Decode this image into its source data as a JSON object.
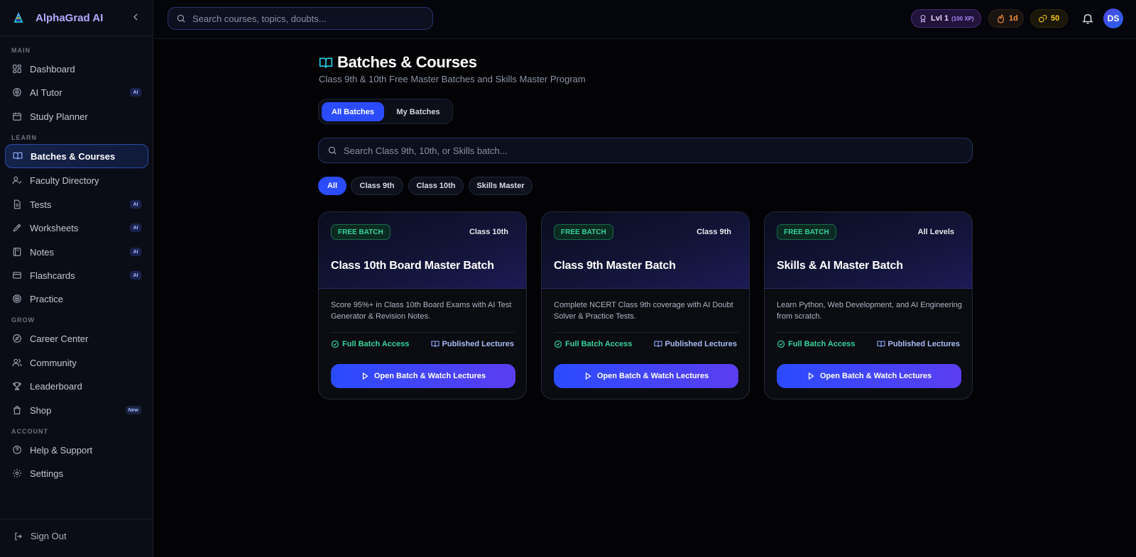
{
  "app": {
    "name": "AlphaGrad AI"
  },
  "topbar": {
    "search_placeholder": "Search courses, topics, doubts...",
    "level": "Lvl 1",
    "xp": "(100 XP)",
    "streak": "1d",
    "coins": "50",
    "avatar_initials": "DS"
  },
  "sidebar": {
    "sections": [
      "MAIN",
      "LEARN",
      "GROW",
      "ACCOUNT"
    ],
    "items": [
      {
        "label": "Dashboard",
        "icon": "dashboard-icon"
      },
      {
        "label": "AI Tutor",
        "icon": "brain-icon",
        "badge": "AI"
      },
      {
        "label": "Study Planner",
        "icon": "calendar-icon"
      },
      {
        "label": "Batches & Courses",
        "icon": "book-open-icon",
        "active": true
      },
      {
        "label": "Faculty Directory",
        "icon": "user-check-icon"
      },
      {
        "label": "Tests",
        "icon": "file-text-icon",
        "badge": "AI"
      },
      {
        "label": "Worksheets",
        "icon": "pen-icon",
        "badge": "AI"
      },
      {
        "label": "Notes",
        "icon": "notebook-icon",
        "badge": "AI"
      },
      {
        "label": "Flashcards",
        "icon": "cards-icon",
        "badge": "AI"
      },
      {
        "label": "Practice",
        "icon": "target-icon"
      },
      {
        "label": "Career Center",
        "icon": "compass-icon"
      },
      {
        "label": "Community",
        "icon": "users-icon"
      },
      {
        "label": "Leaderboard",
        "icon": "trophy-icon"
      },
      {
        "label": "Shop",
        "icon": "shopping-bag-icon",
        "badge": "New"
      },
      {
        "label": "Help & Support",
        "icon": "help-circle-icon"
      },
      {
        "label": "Settings",
        "icon": "gear-icon"
      }
    ],
    "sign_out": "Sign Out"
  },
  "main": {
    "title": "Batches & Courses",
    "subtitle": "Class 9th & 10th Free Master Batches and Skills Master Program",
    "tabs": [
      "All Batches",
      "My Batches"
    ],
    "search_placeholder": "Search Class 9th, 10th, or Skills batch...",
    "filters": [
      "All",
      "Class 9th",
      "Class 10th",
      "Skills Master"
    ],
    "cards": [
      {
        "badge": "FREE BATCH",
        "level": "Class 10th",
        "title": "Class 10th Board Master Batch",
        "description": "Score 95%+ in Class 10th Board Exams with AI Test Generator & Revision Notes.",
        "access": "Full Batch Access",
        "lectures": "Published Lectures",
        "button": "Open Batch & Watch Lectures"
      },
      {
        "badge": "FREE BATCH",
        "level": "Class 9th",
        "title": "Class 9th Master Batch",
        "description": "Complete NCERT Class 9th coverage with AI Doubt Solver & Practice Tests.",
        "access": "Full Batch Access",
        "lectures": "Published Lectures",
        "button": "Open Batch & Watch Lectures"
      },
      {
        "badge": "FREE BATCH",
        "level": "All Levels",
        "title": "Skills & AI Master Batch",
        "description": "Learn Python, Web Development, and AI Engineering from scratch.",
        "access": "Full Batch Access",
        "lectures": "Published Lectures",
        "button": "Open Batch & Watch Lectures"
      }
    ]
  },
  "colors": {
    "accent": "#2b4bff",
    "brand_text": "#b7a9ff",
    "success": "#34d399",
    "streak": "#fb923c",
    "coin": "#facc15",
    "background": "#030306"
  }
}
